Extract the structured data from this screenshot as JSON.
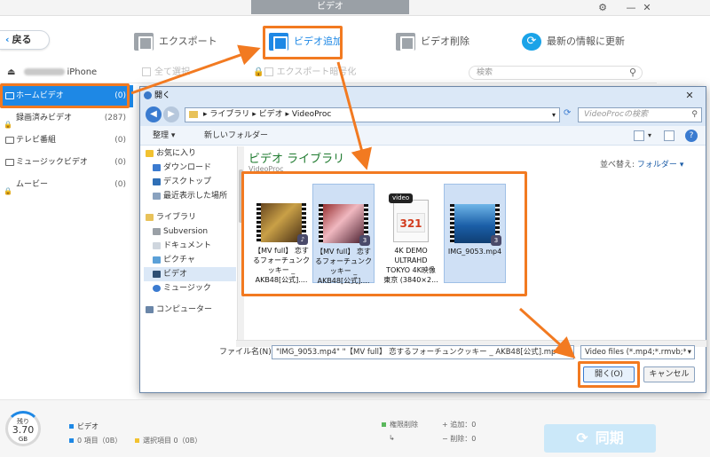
{
  "app": {
    "window_title": "ビデオ"
  },
  "toolbar": {
    "back_label": "戻る",
    "export_label": "エクスポート",
    "add_label": "ビデオ追加",
    "delete_label": "ビデオ削除",
    "refresh_label": "最新の情報に更新"
  },
  "device": {
    "name": "iPhone"
  },
  "subheader": {
    "select_all": "全て選択",
    "encrypt_export": "エクスポート暗号化",
    "search_placeholder": "検索"
  },
  "sidebar": {
    "items": [
      {
        "label": "ホームビデオ",
        "count": "(0)"
      },
      {
        "label": "録画済みビデオ",
        "count": "(287)"
      },
      {
        "label": "テレビ番組",
        "count": "(0)"
      },
      {
        "label": "ミュージックビデオ",
        "count": "(0)"
      },
      {
        "label": "ムービー",
        "count": "(0)"
      }
    ]
  },
  "dialog": {
    "title": "開く",
    "breadcrumb": [
      "ライブラリ",
      "ビデオ",
      "VideoProc"
    ],
    "search_placeholder": "VideoProcの検索",
    "organize": "整理",
    "new_folder": "新しいフォルダー",
    "nav": {
      "favorites": "お気に入り",
      "download": "ダウンロード",
      "desktop": "デスクトップ",
      "recent": "最近表示した場所",
      "libraries": "ライブラリ",
      "subversion": "Subversion",
      "documents": "ドキュメント",
      "pictures": "ピクチャ",
      "video": "ビデオ",
      "music": "ミュージック",
      "computer": "コンピューター"
    },
    "library_title": "ビデオ ライブラリ",
    "library_sub": "VideoProc",
    "arrange_label": "並べ替え:",
    "arrange_value": "フォルダー",
    "files": [
      {
        "label": "【MV full】 恋するフォーチュンクッキー _ AKB48[公式]....",
        "selected": false
      },
      {
        "label": "【MV full】 恋するフォーチュンクッキー _ AKB48[公式]....",
        "selected": true
      },
      {
        "label": "4K DEMO ULTRAHD TOKYO 4K映像 東京 (3840×2...",
        "selected": false
      },
      {
        "label": "IMG_9053.mp4",
        "selected": true
      }
    ],
    "video_tag": "video",
    "doc_number": "321",
    "filename_label": "ファイル名(N):",
    "filename_value": "\"IMG_9053.mp4\" \"【MV full】 恋するフォーチュンクッキー _ AKB48[公式].mp4\"",
    "filetype": "Video files (*.mp4;*.rmvb;*",
    "open_button": "開く(O)",
    "cancel_button": "キャンセル"
  },
  "footer": {
    "storage_label": "残り",
    "storage_value": "3.70",
    "storage_unit": "GB",
    "section_title": "ビデオ",
    "items_count": "0 項目（0B）",
    "selected_count": "選択項目 0（0B）",
    "perm_delete": "権限削除",
    "added": "追加：0",
    "deleted": "削除：0",
    "sync_label": "同期"
  },
  "colors": {
    "accent": "#1e88e5",
    "highlight": "#f27a21"
  }
}
